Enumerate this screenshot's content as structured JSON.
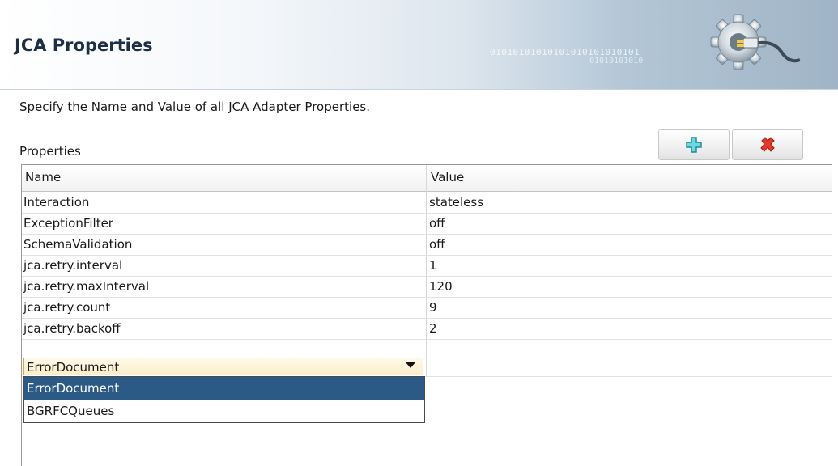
{
  "header": {
    "title": "JCA Properties",
    "binary_line1": "01010101010101010101010101",
    "binary_line2": "01010101010"
  },
  "description": "Specify the Name and Value of all JCA Adapter Properties.",
  "properties_label": "Properties",
  "toolbar": {
    "add_icon": "plus-icon",
    "delete_icon": "delete-x-icon",
    "add_color": "#2fb8c8",
    "delete_color": "#d32020"
  },
  "table": {
    "columns": [
      "Name",
      "Value"
    ],
    "rows": [
      {
        "name": "Interaction",
        "value": "stateless"
      },
      {
        "name": "ExceptionFilter",
        "value": "off"
      },
      {
        "name": "SchemaValidation",
        "value": "off"
      },
      {
        "name": "jca.retry.interval",
        "value": "1"
      },
      {
        "name": "jca.retry.maxInterval",
        "value": "120"
      },
      {
        "name": "jca.retry.count",
        "value": "9"
      },
      {
        "name": "jca.retry.backoff",
        "value": "2"
      }
    ]
  },
  "combo": {
    "selected": "ErrorDocument",
    "options": [
      "ErrorDocument",
      "BGRFCQueues"
    ],
    "highlight_color": "#2c5a86"
  }
}
